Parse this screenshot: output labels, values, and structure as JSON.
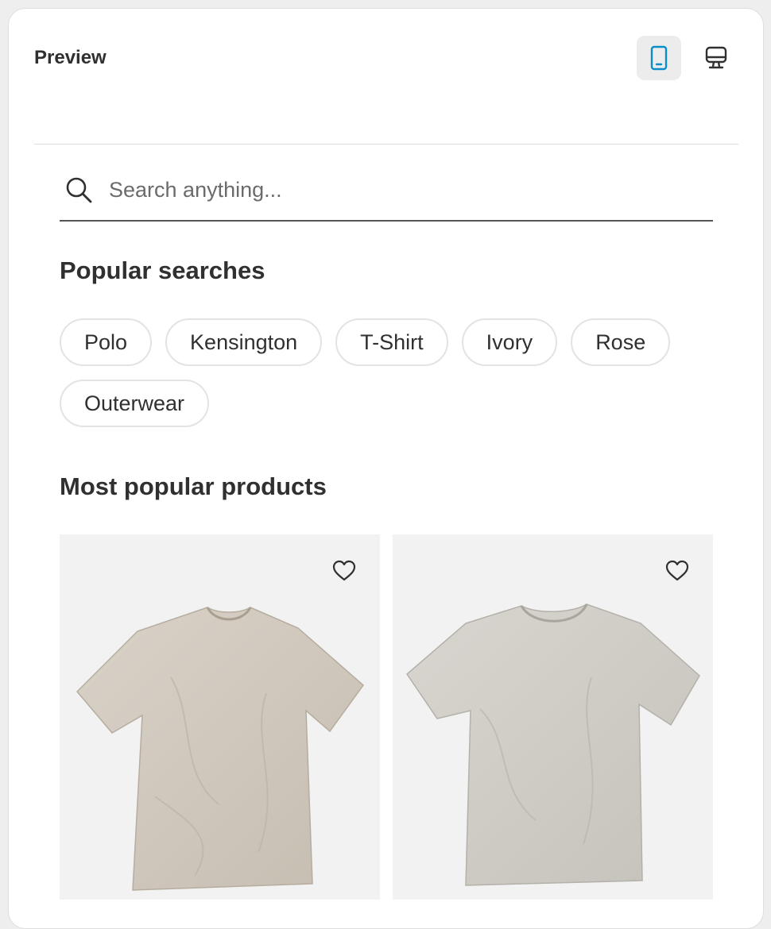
{
  "header": {
    "title": "Preview",
    "views": [
      {
        "name": "mobile",
        "icon": "mobile-phone-icon",
        "active": true,
        "color": "#0a8ec9"
      },
      {
        "name": "desktop",
        "icon": "desktop-monitor-icon",
        "active": false,
        "color": "#303030"
      }
    ]
  },
  "search": {
    "placeholder": "Search anything...",
    "value": "",
    "icon": "search-icon"
  },
  "popular_searches": {
    "title": "Popular searches",
    "chips": [
      "Polo",
      "Kensington",
      "T-Shirt",
      "Ivory",
      "Rose",
      "Outerwear"
    ]
  },
  "popular_products": {
    "title": "Most popular products",
    "products": [
      {
        "image": "beige t-shirt",
        "icon": "heart-icon"
      },
      {
        "image": "grey t-shirt",
        "icon": "heart-icon"
      }
    ]
  },
  "colors": {
    "accent": "#0a8ec9",
    "text": "#303030",
    "tile_bg": "#f2f2f2"
  }
}
